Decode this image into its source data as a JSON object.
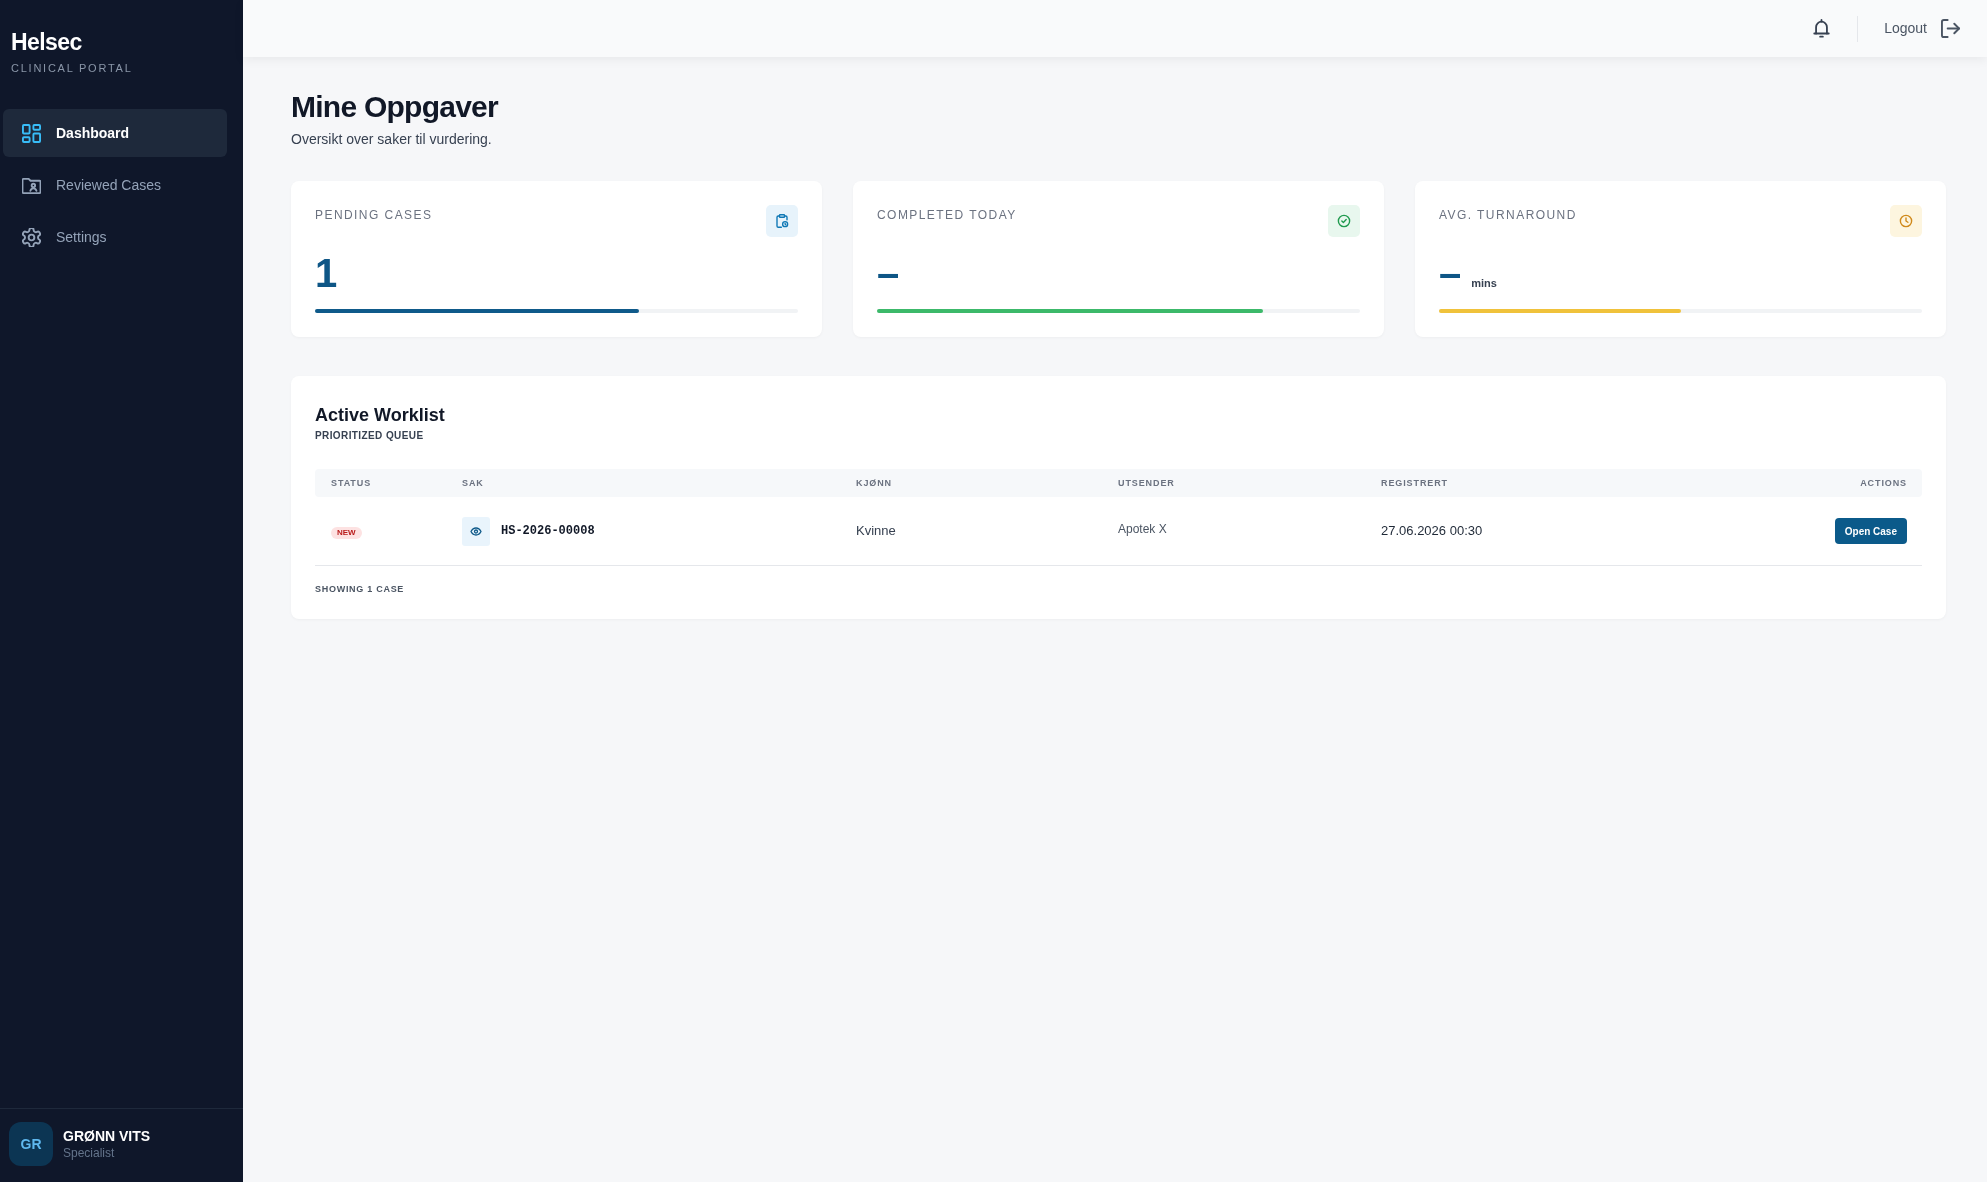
{
  "sidebar": {
    "logo": "Helsec",
    "subtitle": "CLINICAL PORTAL",
    "items": [
      {
        "label": "Dashboard",
        "selected": true
      },
      {
        "label": "Reviewed Cases",
        "selected": false
      },
      {
        "label": "Settings",
        "selected": false
      }
    ],
    "user": {
      "initials": "GR",
      "name": "GRØNN VITS",
      "role": "Specialist"
    }
  },
  "top_bar": {
    "logout": "Logout"
  },
  "page": {
    "title": "Mine Oppgaver",
    "subtitle": "Oversikt over saker til vurdering."
  },
  "stats": [
    {
      "label": "PENDING CASES",
      "value": "1",
      "level": 0.67,
      "color": "#0f5a8a"
    },
    {
      "label": "COMPLETED TODAY",
      "value": "–",
      "level": 0.8,
      "color": "#3cb96a"
    },
    {
      "label": "AVG. TURNAROUND",
      "value": "–",
      "unit": "mins",
      "level": 0.5,
      "color": "#f0c23b"
    }
  ],
  "worklist": {
    "title": "Active Worklist",
    "subtitle": "PRIORITIZED QUEUE",
    "columns": [
      "STATUS",
      "SAK",
      "KJØNN",
      "UTSENDER",
      "REGISTRERT",
      "ACTIONS"
    ],
    "rows": [
      {
        "status": "NEW",
        "case": "HS-2026-00008",
        "gender": "Kvinne",
        "sender": "Apotek X",
        "registered": "27.06.2026 00:30",
        "action": "Open Case"
      }
    ],
    "footer": "SHOWING 1 CASE"
  }
}
